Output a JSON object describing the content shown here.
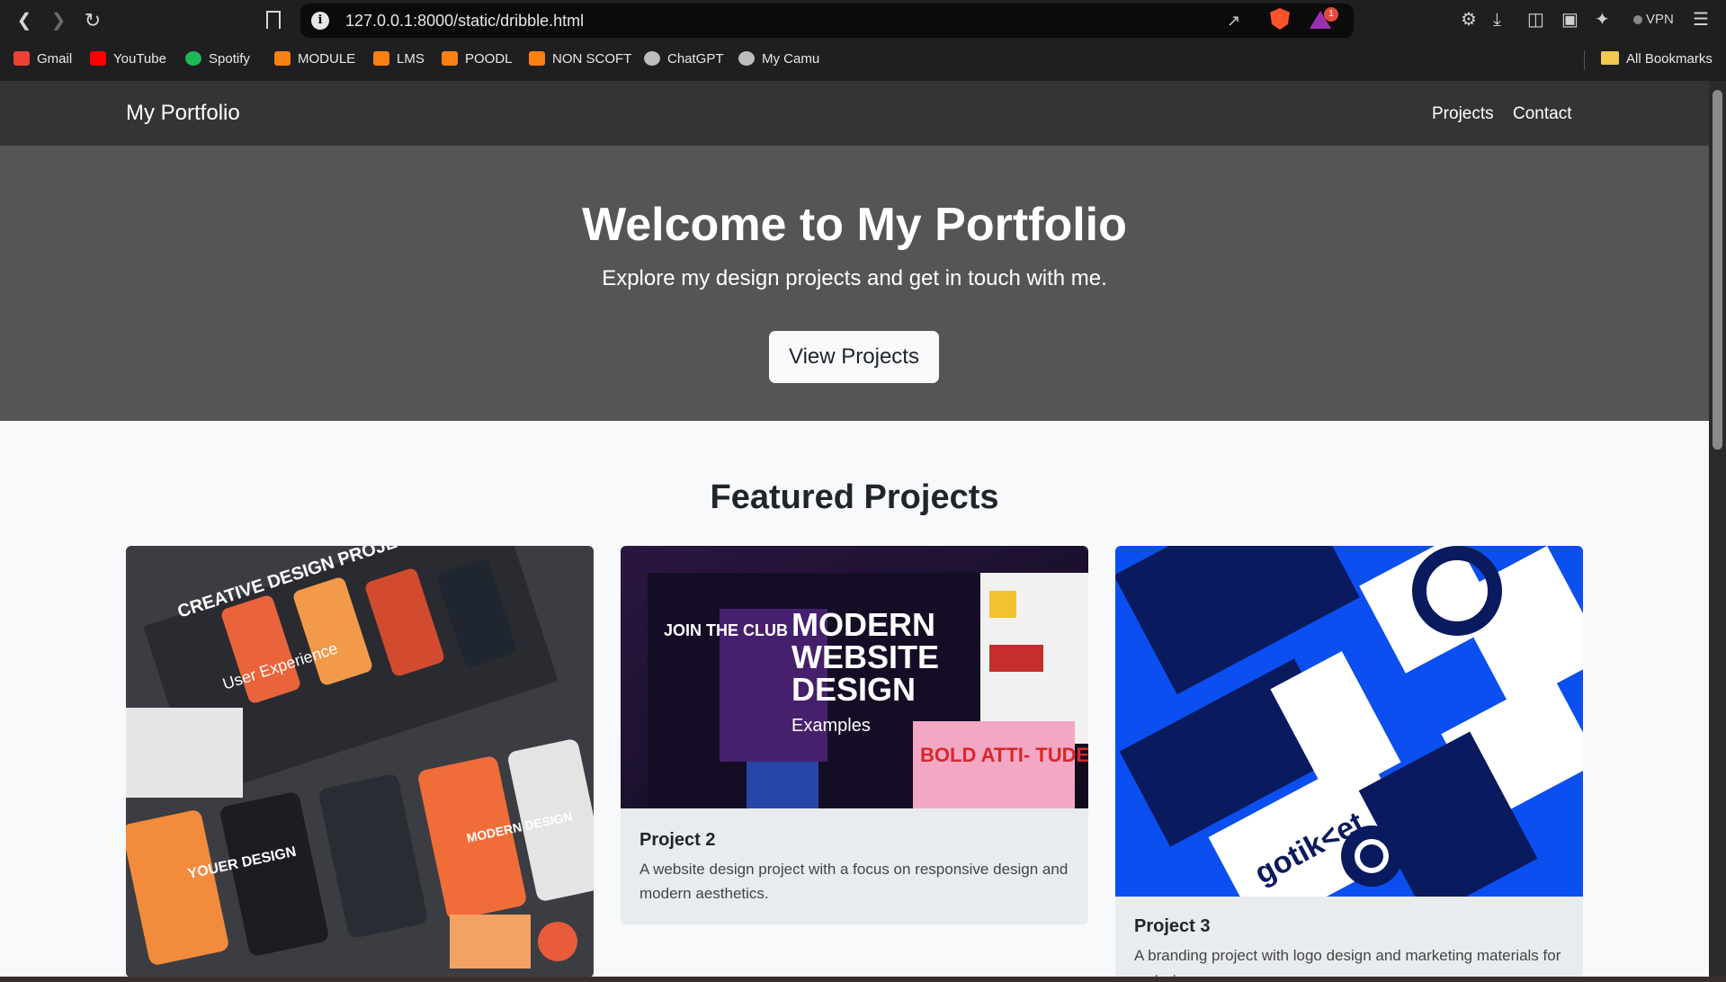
{
  "browser": {
    "url": "127.0.0.1:8000/static/dribble.html",
    "vpn_label": "VPN",
    "notification_count": "1",
    "bookmarks": [
      {
        "label": "Gmail",
        "icon": "gmail-icon",
        "color": "#ea4335"
      },
      {
        "label": "YouTube",
        "icon": "youtube-icon",
        "color": "#ff0000"
      },
      {
        "label": "Spotify",
        "icon": "spotify-icon",
        "color": "#1db954"
      },
      {
        "label": "MODULE",
        "icon": "moodle-icon",
        "color": "#f98012"
      },
      {
        "label": "LMS",
        "icon": "moodle-icon",
        "color": "#f98012"
      },
      {
        "label": "POODL",
        "icon": "moodle-icon",
        "color": "#f98012"
      },
      {
        "label": "NON SCOFT",
        "icon": "moodle-icon",
        "color": "#f98012"
      },
      {
        "label": "ChatGPT",
        "icon": "chatgpt-icon",
        "color": "#bdbdbd"
      },
      {
        "label": "My Camu",
        "icon": "globe-icon",
        "color": "#bdbdbd"
      }
    ],
    "all_bookmarks_label": "All Bookmarks"
  },
  "site": {
    "brand": "My Portfolio",
    "nav": {
      "projects": "Projects",
      "contact": "Contact"
    },
    "hero": {
      "title": "Welcome to My Portfolio",
      "subtitle": "Explore my design projects and get in touch with me.",
      "button": "View Projects"
    },
    "featured_title": "Featured Projects",
    "projects": [
      {
        "title": "",
        "text": ""
      },
      {
        "title": "Project 2",
        "text": "A website design project with a focus on responsive design and modern aesthetics.",
        "image_text": {
          "l1": "MODERN",
          "l2": "WEBSITE",
          "l3": "DESIGN",
          "l4": "Examples",
          "club": "JOIN THE CLUB",
          "bold": "BOLD ATTI- TUDE"
        }
      },
      {
        "title": "Project 3",
        "text": "A branding project with logo design and marketing materials for a startup.",
        "image_text": {
          "brand": "gotik<et"
        }
      }
    ],
    "project1_image_text": {
      "a": "CREATIVE DESIGN PROJECT",
      "b": "User Experience",
      "c": "YOUER DESIGN",
      "d": "MODERN DESIGN"
    }
  },
  "colors": {
    "nav_bg": "#343434",
    "hero_bg": "#555555",
    "page_bg": "#f8f9fa",
    "card_bg": "#e9ecef",
    "gotiket_blue": "#0b4ff0"
  }
}
